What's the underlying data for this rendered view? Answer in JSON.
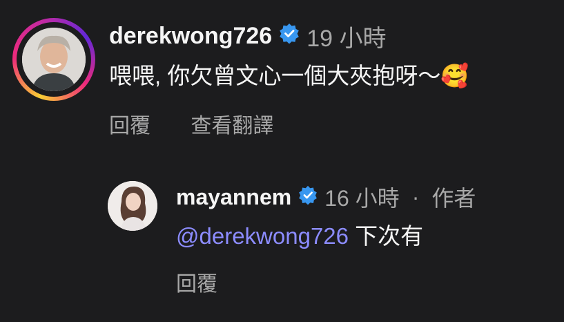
{
  "comment": {
    "username": "derekwong726",
    "time": "19 小時",
    "text": "喂喂, 你欠曾文心一個大夾抱呀～",
    "emoji": "🥰",
    "actions": {
      "reply": "回覆",
      "translate": "查看翻譯"
    }
  },
  "reply": {
    "username": "mayannem",
    "time": "16 小時",
    "separator": "·",
    "author_tag": "作者",
    "mention": "@derekwong726",
    "text": " 下次有",
    "actions": {
      "reply": "回覆"
    }
  },
  "colors": {
    "background": "#1c1c1e",
    "verified": "#3897f0",
    "mention": "#8c8cff",
    "secondary_text": "#a8a8a8"
  },
  "icons": [
    "verified-badge-icon"
  ]
}
